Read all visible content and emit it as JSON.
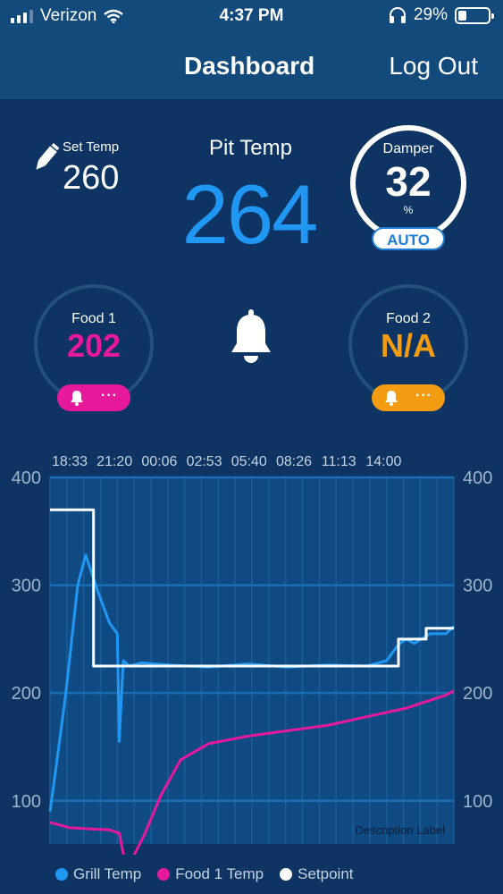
{
  "status_bar": {
    "carrier": "Verizon",
    "time": "4:37 PM",
    "battery": "29%"
  },
  "header": {
    "title": "Dashboard",
    "logout_label": "Log Out"
  },
  "set_temp": {
    "label": "Set Temp",
    "value": "260"
  },
  "pit_temp": {
    "label": "Pit Temp",
    "value": "264"
  },
  "damper": {
    "label": "Damper",
    "value": "32",
    "unit": "%",
    "mode": "AUTO"
  },
  "food1": {
    "label": "Food 1",
    "value": "202",
    "color": "#e7199b"
  },
  "food2": {
    "label": "Food  2",
    "value": "N/A",
    "color": "#f39c12"
  },
  "colors": {
    "grill": "#1f97f3",
    "food1": "#e7199b",
    "setpoint": "#ffffff",
    "food2": "#f39c12"
  },
  "chart_data": {
    "type": "line",
    "time_labels": [
      "18:33",
      "21:20",
      "00:06",
      "02:53",
      "05:40",
      "08:26",
      "11:13",
      "14:00"
    ],
    "y_ticks": [
      100,
      200,
      300,
      400
    ],
    "ylim": [
      60,
      400
    ],
    "description": "Description Label",
    "series": [
      {
        "name": "Grill Temp",
        "color": "#1f97f3",
        "x": [
          0,
          0.15,
          0.4,
          0.7,
          0.9,
          1.2,
          1.5,
          1.7,
          1.75,
          1.8,
          1.85,
          2.0,
          2.3,
          3,
          4,
          5,
          6,
          7,
          8,
          8.5,
          8.8,
          9,
          9.2,
          9.6,
          10,
          10.2
        ],
        "values": [
          90,
          130,
          200,
          300,
          328,
          295,
          265,
          255,
          155,
          195,
          230,
          225,
          228,
          226,
          224,
          227,
          224,
          226,
          225,
          230,
          245,
          250,
          246,
          255,
          255,
          262
        ]
      },
      {
        "name": "Food 1 Temp",
        "color": "#e7199b",
        "x": [
          0,
          0.2,
          0.5,
          1.0,
          1.5,
          1.75,
          1.9,
          2.1,
          2.4,
          2.8,
          3.3,
          4,
          5,
          6,
          7,
          8,
          9,
          10,
          10.2
        ],
        "values": [
          80,
          78,
          75,
          74,
          73,
          70,
          42,
          48,
          70,
          105,
          138,
          153,
          160,
          165,
          170,
          178,
          186,
          198,
          202
        ]
      },
      {
        "name": "Setpoint",
        "color": "#ffffff",
        "x": [
          0,
          1.1,
          1.1,
          8.8,
          8.8,
          9.5,
          9.5,
          10.2
        ],
        "values": [
          370,
          370,
          225,
          225,
          250,
          250,
          260,
          260
        ]
      }
    ]
  }
}
